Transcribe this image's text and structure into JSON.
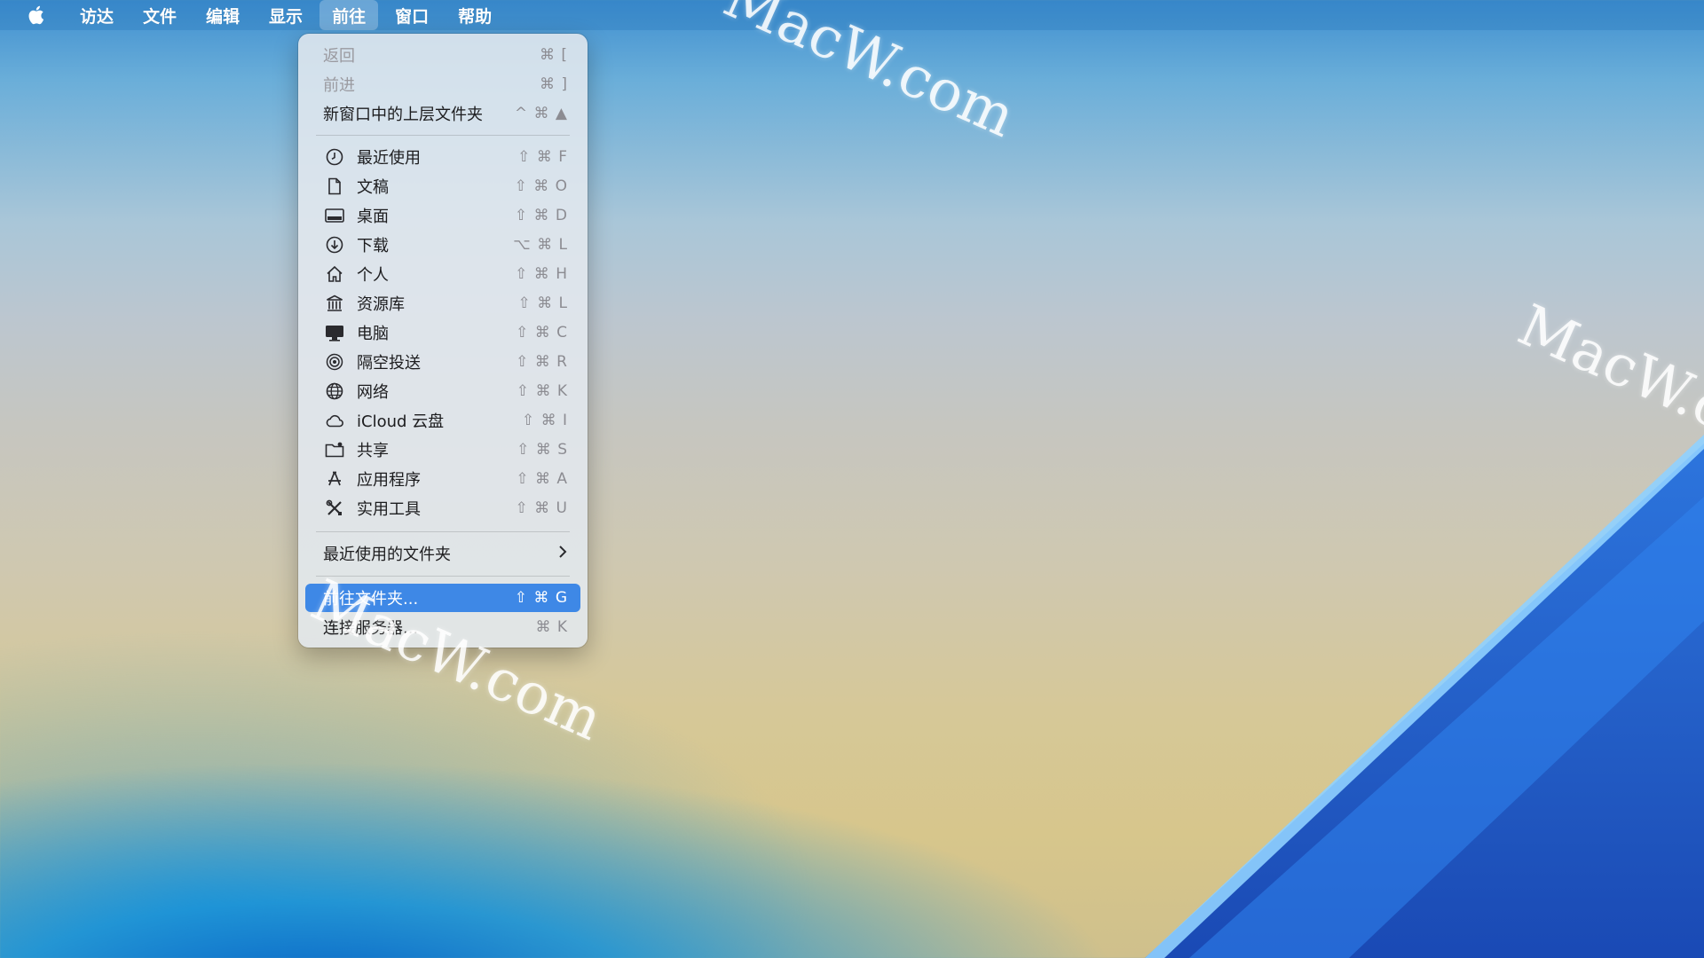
{
  "menubar": {
    "apple_icon": "apple-logo-icon",
    "items": [
      {
        "label": "访达"
      },
      {
        "label": "文件"
      },
      {
        "label": "编辑"
      },
      {
        "label": "显示"
      },
      {
        "label": "前往",
        "active": true
      },
      {
        "label": "窗口"
      },
      {
        "label": "帮助"
      }
    ]
  },
  "go_menu": {
    "back": {
      "label": "返回",
      "shortcut": "⌘ [",
      "disabled": true
    },
    "forward": {
      "label": "前进",
      "shortcut": "⌘ ]",
      "disabled": true
    },
    "enclosing": {
      "label": "新窗口中的上层文件夹",
      "shortcut": "^ ⌘ ▲"
    },
    "places": [
      {
        "label": "最近使用",
        "shortcut": "⇧ ⌘ F",
        "icon": "clock-icon"
      },
      {
        "label": "文稿",
        "shortcut": "⇧ ⌘ O",
        "icon": "document-icon"
      },
      {
        "label": "桌面",
        "shortcut": "⇧ ⌘ D",
        "icon": "desktop-icon"
      },
      {
        "label": "下载",
        "shortcut": "⌥ ⌘ L",
        "icon": "download-icon"
      },
      {
        "label": "个人",
        "shortcut": "⇧ ⌘ H",
        "icon": "home-icon"
      },
      {
        "label": "资源库",
        "shortcut": "⇧ ⌘ L",
        "icon": "library-icon"
      },
      {
        "label": "电脑",
        "shortcut": "⇧ ⌘ C",
        "icon": "computer-icon"
      },
      {
        "label": "隔空投送",
        "shortcut": "⇧ ⌘ R",
        "icon": "airdrop-icon"
      },
      {
        "label": "网络",
        "shortcut": "⇧ ⌘ K",
        "icon": "network-globe-icon"
      },
      {
        "label": "iCloud 云盘",
        "shortcut": "⇧ ⌘ I",
        "icon": "icloud-icon"
      },
      {
        "label": "共享",
        "shortcut": "⇧ ⌘ S",
        "icon": "shared-folder-icon"
      },
      {
        "label": "应用程序",
        "shortcut": "⇧ ⌘ A",
        "icon": "applications-icon"
      },
      {
        "label": "实用工具",
        "shortcut": "⇧ ⌘ U",
        "icon": "utilities-tools-icon"
      }
    ],
    "recent_folders": {
      "label": "最近使用的文件夹",
      "submenu_icon": "chevron-right-icon"
    },
    "go_to_folder": {
      "label": "前往文件夹...",
      "shortcut": "⇧ ⌘ G",
      "selected": true
    },
    "connect_server": {
      "label": "连接服务器...",
      "shortcut": "⌘ K"
    }
  },
  "watermark": {
    "text": "MacW.com"
  }
}
